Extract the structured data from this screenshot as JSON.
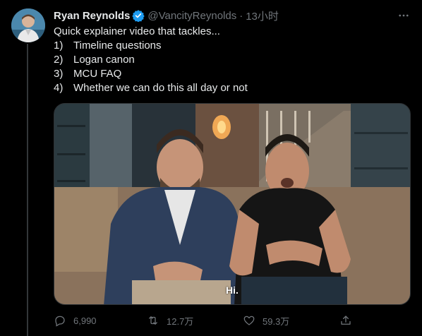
{
  "tweet": {
    "display_name": "Ryan Reynolds",
    "handle": "@VancityReynolds",
    "separator": "·",
    "time": "13小时",
    "lines": [
      {
        "num": "",
        "text": "Quick explainer video that tackles..."
      },
      {
        "num": "1)",
        "text": "Timeline questions"
      },
      {
        "num": "2)",
        "text": "Logan canon"
      },
      {
        "num": "3)",
        "text": "MCU FAQ"
      },
      {
        "num": "4)",
        "text": "Whether we can do this all day or not"
      }
    ],
    "media": {
      "subtitle": "Hi."
    },
    "actions": {
      "reply_count": "6,990",
      "retweet_count": "12.7万",
      "like_count": "59.3万"
    }
  },
  "icons": {
    "verified": "verified-badge-icon",
    "more": "more-options-icon",
    "reply": "reply-icon",
    "retweet": "retweet-icon",
    "like": "like-icon",
    "share": "share-icon"
  },
  "colors": {
    "background": "#000000",
    "text_primary": "#e7e9ea",
    "text_secondary": "#71767b",
    "verified_blue": "#1d9bf0"
  }
}
